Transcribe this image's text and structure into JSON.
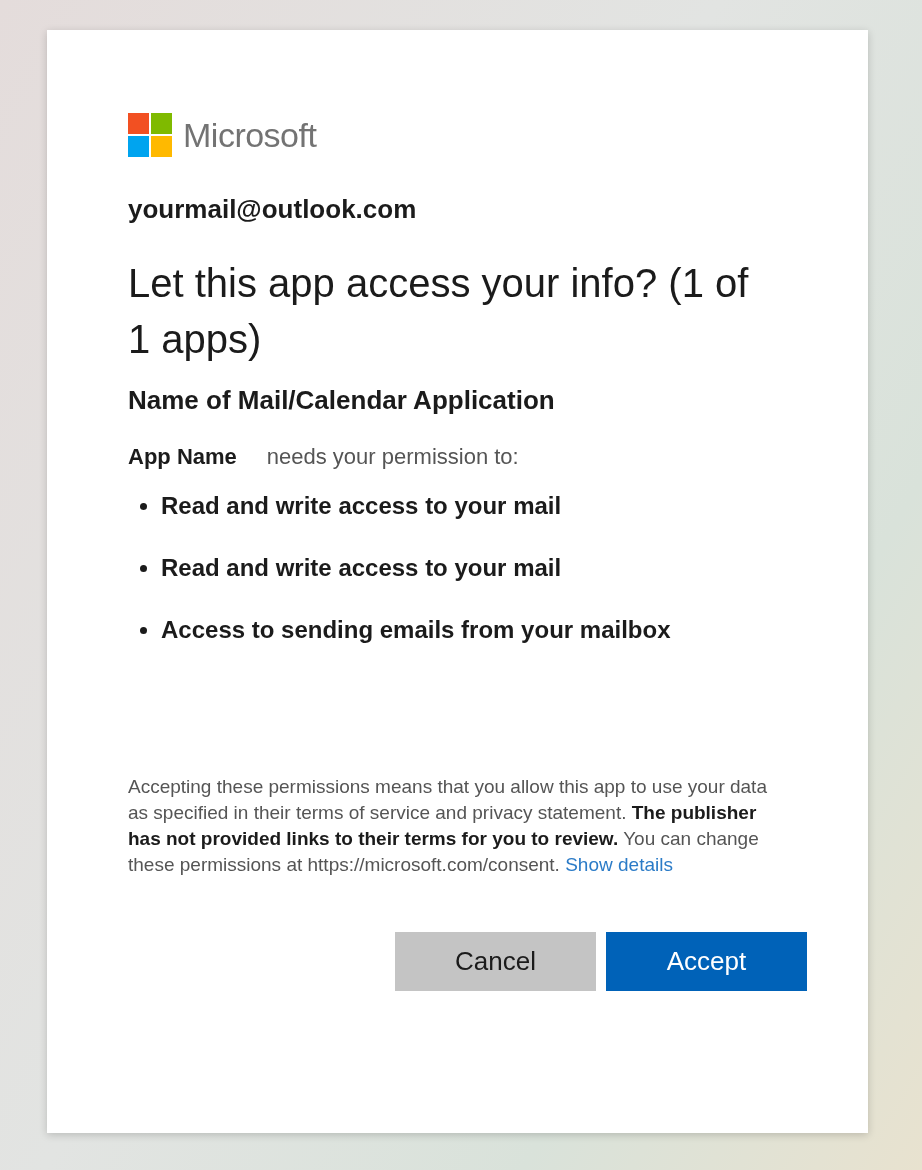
{
  "brand": {
    "name": "Microsoft"
  },
  "account": {
    "email": "yourmail@outlook.com"
  },
  "heading": "Let this app access your info? (1 of 1 apps)",
  "app_title": "Name of Mail/Calendar Application",
  "request": {
    "app_name": "App Name",
    "intro": "needs your permission to:"
  },
  "permissions": [
    {
      "label": "Read and write access to your mail"
    },
    {
      "label": "Read and write access to your mail"
    },
    {
      "label": "Access to sending emails from your mailbox"
    }
  ],
  "notice": {
    "text": "Accepting these permissions means that you allow this app to use your data as specified in their terms of service and privacy statement. **The publisher has not provided links to their terms for you to review.** You can change these permissions at https://microsoft.com/consent.",
    "link": "Show details"
  },
  "buttons": [
    {
      "label": "Cancel",
      "kind": "secondary"
    },
    {
      "label": "Accept",
      "kind": "primary"
    }
  ]
}
